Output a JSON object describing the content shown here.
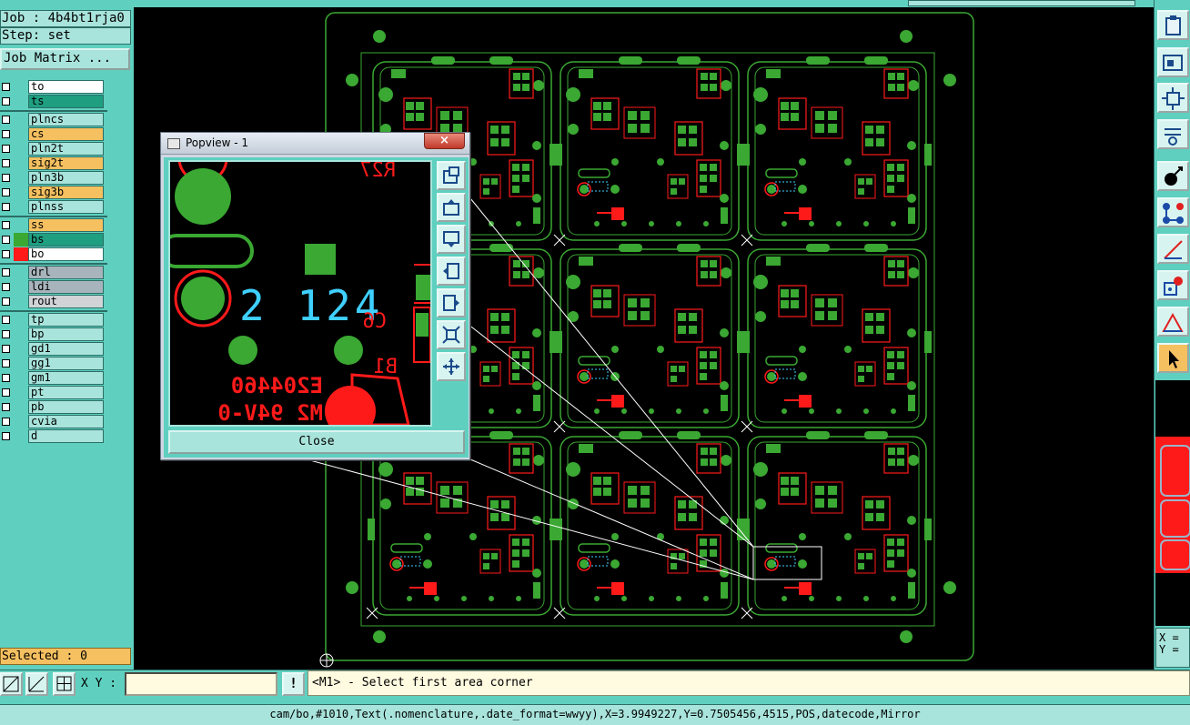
{
  "left_panel": {
    "job_label": "Job : 4b4bt1rja0",
    "step_label": "Step: set",
    "job_matrix_button": "Job Matrix ...",
    "selected_label": "Selected : 0",
    "layers": [
      {
        "name": "to",
        "bg": "#ffffff",
        "color": "",
        "group": 0
      },
      {
        "name": "ts",
        "bg": "#1f9e80",
        "color": "",
        "group": 0
      },
      {
        "name": "plncs",
        "bg": "#a8e4dc",
        "color": "",
        "group": 1
      },
      {
        "name": "cs",
        "bg": "#f5c060",
        "color": "",
        "group": 1
      },
      {
        "name": "pln2t",
        "bg": "#a8e4dc",
        "color": "",
        "group": 1
      },
      {
        "name": "sig2t",
        "bg": "#f5c060",
        "color": "",
        "group": 1
      },
      {
        "name": "pln3b",
        "bg": "#a8e4dc",
        "color": "",
        "group": 1
      },
      {
        "name": "sig3b",
        "bg": "#f5c060",
        "color": "",
        "group": 1
      },
      {
        "name": "plnss",
        "bg": "#a8e4dc",
        "color": "",
        "group": 1
      },
      {
        "name": "ss",
        "bg": "#f5c060",
        "color": "",
        "group": 2
      },
      {
        "name": "bs",
        "bg": "#1f9e80",
        "color": "#3aa832",
        "group": 2
      },
      {
        "name": "bo",
        "bg": "#ffffff",
        "color": "#ff1a1a",
        "group": 2
      },
      {
        "name": "drl",
        "bg": "#a8b4bc",
        "color": "",
        "group": 3
      },
      {
        "name": "ldi",
        "bg": "#a8b4bc",
        "color": "",
        "group": 3
      },
      {
        "name": "rout",
        "bg": "#d0d4d6",
        "color": "",
        "group": 3
      },
      {
        "name": "tp",
        "bg": "#a8e4dc",
        "color": "",
        "group": 4
      },
      {
        "name": "bp",
        "bg": "#a8e4dc",
        "color": "",
        "group": 4
      },
      {
        "name": "gd1",
        "bg": "#a8e4dc",
        "color": "",
        "group": 4
      },
      {
        "name": "gg1",
        "bg": "#a8e4dc",
        "color": "",
        "group": 4
      },
      {
        "name": "gm1",
        "bg": "#a8e4dc",
        "color": "",
        "group": 4
      },
      {
        "name": "pt",
        "bg": "#a8e4dc",
        "color": "",
        "group": 4
      },
      {
        "name": "pb",
        "bg": "#a8e4dc",
        "color": "",
        "group": 4
      },
      {
        "name": "cvia",
        "bg": "#a8e4dc",
        "color": "",
        "group": 4
      },
      {
        "name": "d",
        "bg": "#a8e4dc",
        "color": "",
        "group": 4
      }
    ]
  },
  "bottom": {
    "xy_label": "X Y :",
    "xy_input_value": "",
    "excl_label": "!",
    "prompt": "<M1> - Select first area corner",
    "status": "cam/bo,#1010,Text(.nomenclature,.date_format=wwyy),X=3.9949227,Y=0.7505456,4515,POS,datecode,Mirror"
  },
  "coords": {
    "x_label": "X =",
    "y_label": "Y ="
  },
  "popview": {
    "title": "Popview - 1",
    "close_x": "×",
    "close_button": "Close",
    "pv_text_digits": "2 124",
    "pv_text_ref1": "R27",
    "pv_text_ref2": "C6",
    "pv_text_ref3": "B1",
    "pv_text_ul1": "E204460",
    "pv_text_ul2": "M2 94V-0"
  },
  "colors": {
    "panel_teal": "#5fd0c0",
    "field_light": "#a8e4dc",
    "copper_green": "#3aa832",
    "silk_red": "#ff1a1a",
    "selected_orange": "#f5c060",
    "datecode_cyan": "#3fd0ff"
  },
  "icons": {
    "right_toolbar": [
      "clipboard-icon",
      "zoom-home-icon",
      "fit-screen-icon",
      "measure-tools-icon",
      "rotate-icon",
      "connect-nodes-icon",
      "draw-line-icon",
      "snap-icon",
      "triangle-ruler-icon",
      "pointer-icon"
    ],
    "bottom_toolbar": [
      "zoom-box-icon",
      "zoom-grid-icon",
      "grid-icon"
    ],
    "popview_toolbar": [
      "pv-copy-icon",
      "pv-up-icon",
      "pv-down-icon",
      "pv-left-icon",
      "pv-right-icon",
      "pv-fit-icon",
      "pv-zoom-icon"
    ]
  }
}
